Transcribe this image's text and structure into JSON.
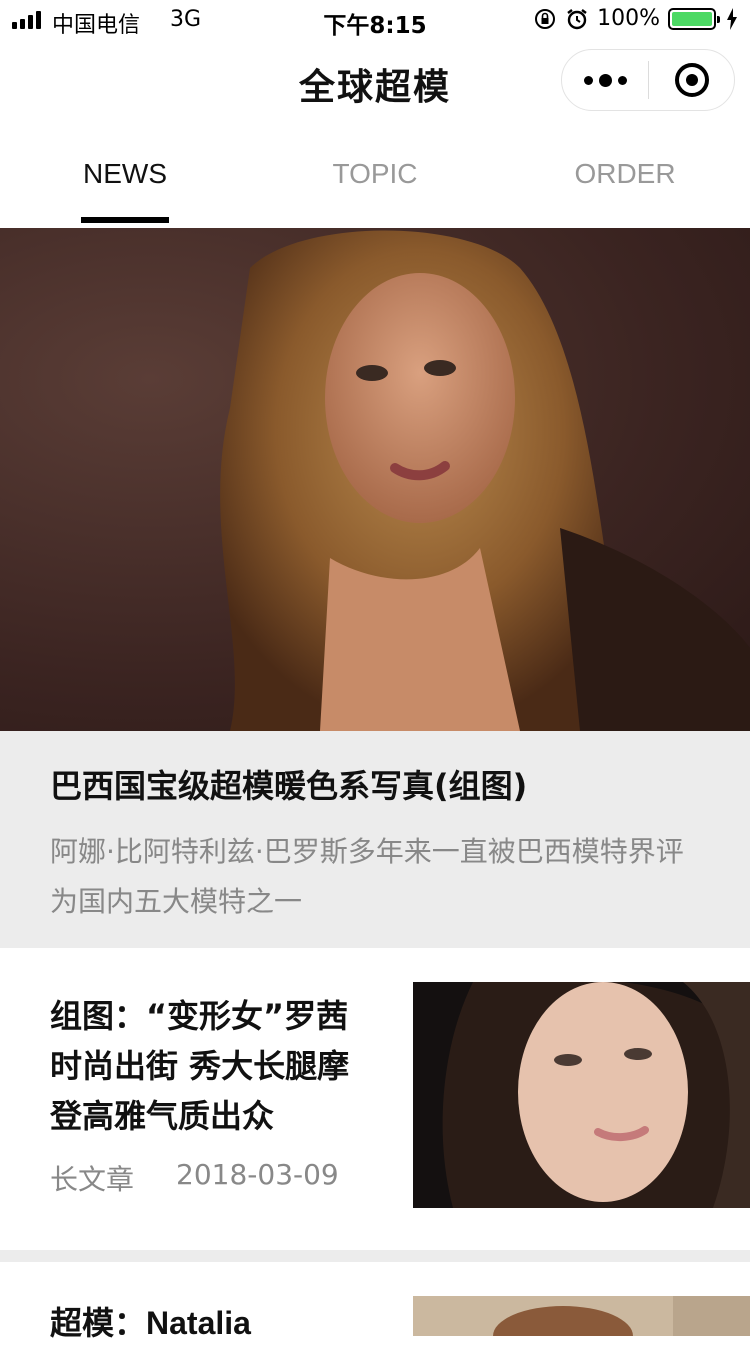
{
  "status_bar": {
    "carrier": "中国电信",
    "network": "3G",
    "time": "下午8:15",
    "battery_percent_text": "100%",
    "battery_level": 1.0,
    "battery_color": "#4cd964",
    "icons": [
      "signal-icon",
      "orientation-lock-icon",
      "alarm-icon",
      "battery-icon",
      "charging-icon"
    ]
  },
  "nav": {
    "title": "全球超模",
    "capsule_icons": [
      "more-dots-icon",
      "close-target-icon"
    ]
  },
  "tabs": [
    {
      "label": "NEWS",
      "active": true
    },
    {
      "label": "TOPIC",
      "active": false
    },
    {
      "label": "ORDER",
      "active": false
    }
  ],
  "featured": {
    "image": "model-portrait-photo",
    "title": "巴西国宝级超模暖色系写真(组图)",
    "description": "阿娜·比阿特利兹·巴罗斯多年来一直被巴西模特界评为国内五大模特之一"
  },
  "articles": [
    {
      "title": "组图：“变形女”罗茜时尚出街 秀大长腿摩登高雅气质出众",
      "category": "长文章",
      "date": "2018-03-09",
      "image": "model-face-photo"
    },
    {
      "title": "超模：Natalia",
      "image": "model-photo-partial"
    }
  ]
}
